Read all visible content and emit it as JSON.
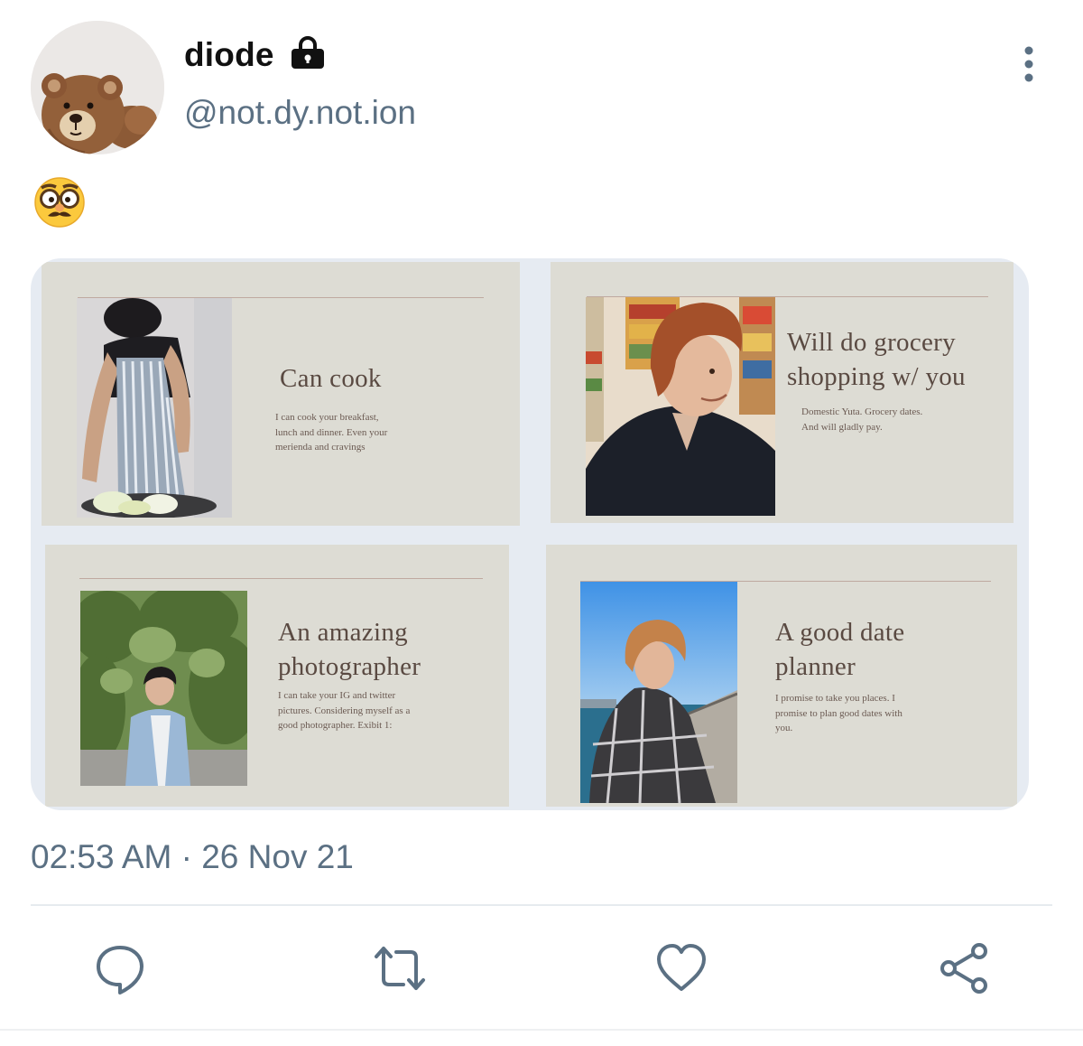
{
  "author": {
    "display_name": "diode",
    "handle": "@not.dy.not.ion",
    "protected_icon": "lock-icon",
    "avatar_icon": "teddy-bear-avatar"
  },
  "menu_icon": "more-vertical-icon",
  "tweet": {
    "text_emoji": "nerd-disguise-face-emoji"
  },
  "media": [
    {
      "title": "Can cook",
      "body": "I can cook your breakfast, lunch and dinner. Even your merienda and cravings",
      "photo": "person-cooking-photo"
    },
    {
      "title": "Will do grocery shopping w/ you",
      "body": "Domestic Yuta. Grocery dates. And will gladly pay.",
      "photo": "person-in-store-photo"
    },
    {
      "title": "An amazing photographer",
      "body": "I can take your IG and twitter pictures. Considering myself as a good photographer. Exibit 1:",
      "photo": "person-in-garden-photo"
    },
    {
      "title": "A good date planner",
      "body": "I promise to take you places. I promise to plan good dates with you.",
      "photo": "person-by-sea-photo"
    }
  ],
  "timestamp": "02:53 AM · 26 Nov 21",
  "actions": [
    {
      "name": "reply",
      "icon": "reply-icon"
    },
    {
      "name": "retweet",
      "icon": "retweet-icon"
    },
    {
      "name": "like",
      "icon": "heart-icon"
    },
    {
      "name": "share",
      "icon": "share-icon"
    }
  ],
  "colors": {
    "handle_gray": "#5b7083",
    "slide_background": "#dddcd4",
    "slide_text": "#5a4a42",
    "icon_gray": "#5b7083"
  }
}
